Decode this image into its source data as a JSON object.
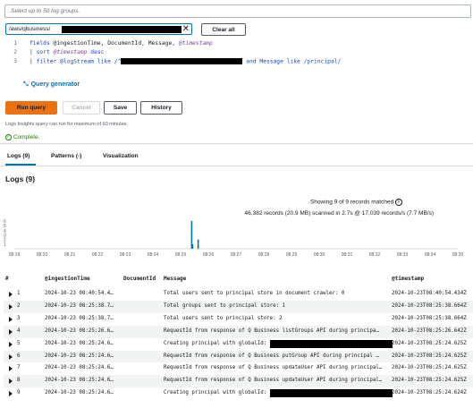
{
  "log_groups": {
    "placeholder": "Select up to 50 log groups.",
    "token_text": "/aws/qbusiness/",
    "clear_label": "Clear all"
  },
  "editor": {
    "lines": [
      {
        "num": "1",
        "parts": [
          {
            "t": "fields ",
            "c": "kw"
          },
          {
            "t": "@ingestionTime, DocumentId, Message, ",
            "c": ""
          },
          {
            "t": "@timestamp",
            "c": "var"
          }
        ]
      },
      {
        "num": "2",
        "parts": [
          {
            "t": "| ",
            "c": ""
          },
          {
            "t": "sort ",
            "c": "kw"
          },
          {
            "t": "@timestamp",
            "c": "var"
          },
          {
            "t": " desc",
            "c": "kw"
          }
        ]
      },
      {
        "num": "3",
        "parts": [
          {
            "t": "| ",
            "c": ""
          },
          {
            "t": "filter ",
            "c": "kw"
          },
          {
            "t": "@logStream like /^",
            "c": "lnk"
          }
        ]
      }
    ],
    "line3_suffix": " and Message like /principal/"
  },
  "query_generator_label": "Query generator",
  "actions": {
    "run": "Run query",
    "cancel": "Cancel",
    "save": "Save",
    "history": "History"
  },
  "note": "Logs Insights query can run for maximum of 60 minutes.",
  "status": "Complete.",
  "tabs": [
    "Logs (9)",
    "Patterns (-)",
    "Visualization"
  ],
  "logs_title": "Logs (9)",
  "summary": {
    "line1": "Showing 9 of 9 records matched",
    "line2": "46,382 records (20.9 MB) scanned in 2.7s @ 17,039 records/s (7.7 MB/s)"
  },
  "chart_data": {
    "type": "bar",
    "ylim": [
      0,
      6
    ],
    "yticks": [
      "6",
      "5",
      "4",
      "3",
      "2",
      "1"
    ],
    "xticks": [
      "08:19",
      "08:20",
      "08:21",
      "08:22",
      "08:23",
      "08:24",
      "08:25",
      "08:26",
      "08:27",
      "08:28",
      "08:29",
      "08:30",
      "08:31",
      "08:32",
      "08:33",
      "08:34",
      "08:35"
    ],
    "bars": [
      {
        "time": "08:25:24",
        "value": 6
      },
      {
        "time": "08:25:26",
        "value": 1
      },
      {
        "time": "08:25:38",
        "value": 2
      }
    ]
  },
  "table": {
    "headers": [
      "#",
      "@ingestionTime",
      "DocumentId",
      "Message",
      "@timestamp"
    ],
    "rows": [
      {
        "n": "1",
        "ingestion": "2024-10-23 08:40:54.4…",
        "message": "Total users sent to principal store in document crawler: 0",
        "timestamp": "2024-10-23T08:40:54.434Z",
        "redacted": false
      },
      {
        "n": "2",
        "ingestion": "2024-10-23 08:25:38.7…",
        "message": "Total groups sent to principal store: 1",
        "timestamp": "2024-10-23T08:25:38.664Z",
        "redacted": false
      },
      {
        "n": "3",
        "ingestion": "2024-10-23 08:25:38.7…",
        "message": "Total users sent to principal store: 2",
        "timestamp": "2024-10-23T08:25:38.664Z",
        "redacted": false
      },
      {
        "n": "4",
        "ingestion": "2024-10-23 08:25:26.6…",
        "message": "RequestId from response of Q Business listGroups API during principa…",
        "timestamp": "2024-10-23T08:25:26.642Z",
        "redacted": false
      },
      {
        "n": "5",
        "ingestion": "2024-10-23 08:25:24.6…",
        "message": "Creating principal with globalId:",
        "timestamp": "2024-10-23T08:25:24.625Z",
        "redacted": true
      },
      {
        "n": "6",
        "ingestion": "2024-10-23 08:25:24.6…",
        "message": "RequestId from response of Q Business putGroup API during principal …",
        "timestamp": "2024-10-23T08:25:24.625Z",
        "redacted": false
      },
      {
        "n": "7",
        "ingestion": "2024-10-23 08:25:24.6…",
        "message": "RequestId from response of Q Business updateUser API during principal…",
        "timestamp": "2024-10-23T08:25:24.625Z",
        "redacted": false
      },
      {
        "n": "8",
        "ingestion": "2024-10-23 08:25:24.6…",
        "message": "RequestId from response of Q Business updateUser API during principal…",
        "timestamp": "2024-10-23T08:25:24.625Z",
        "redacted": false
      },
      {
        "n": "9",
        "ingestion": "2024-10-23 08:25:24.6…",
        "message": "Creating principal with globalId:",
        "timestamp": "2024-10-23T08:25:24.624Z",
        "redacted": true
      }
    ]
  }
}
